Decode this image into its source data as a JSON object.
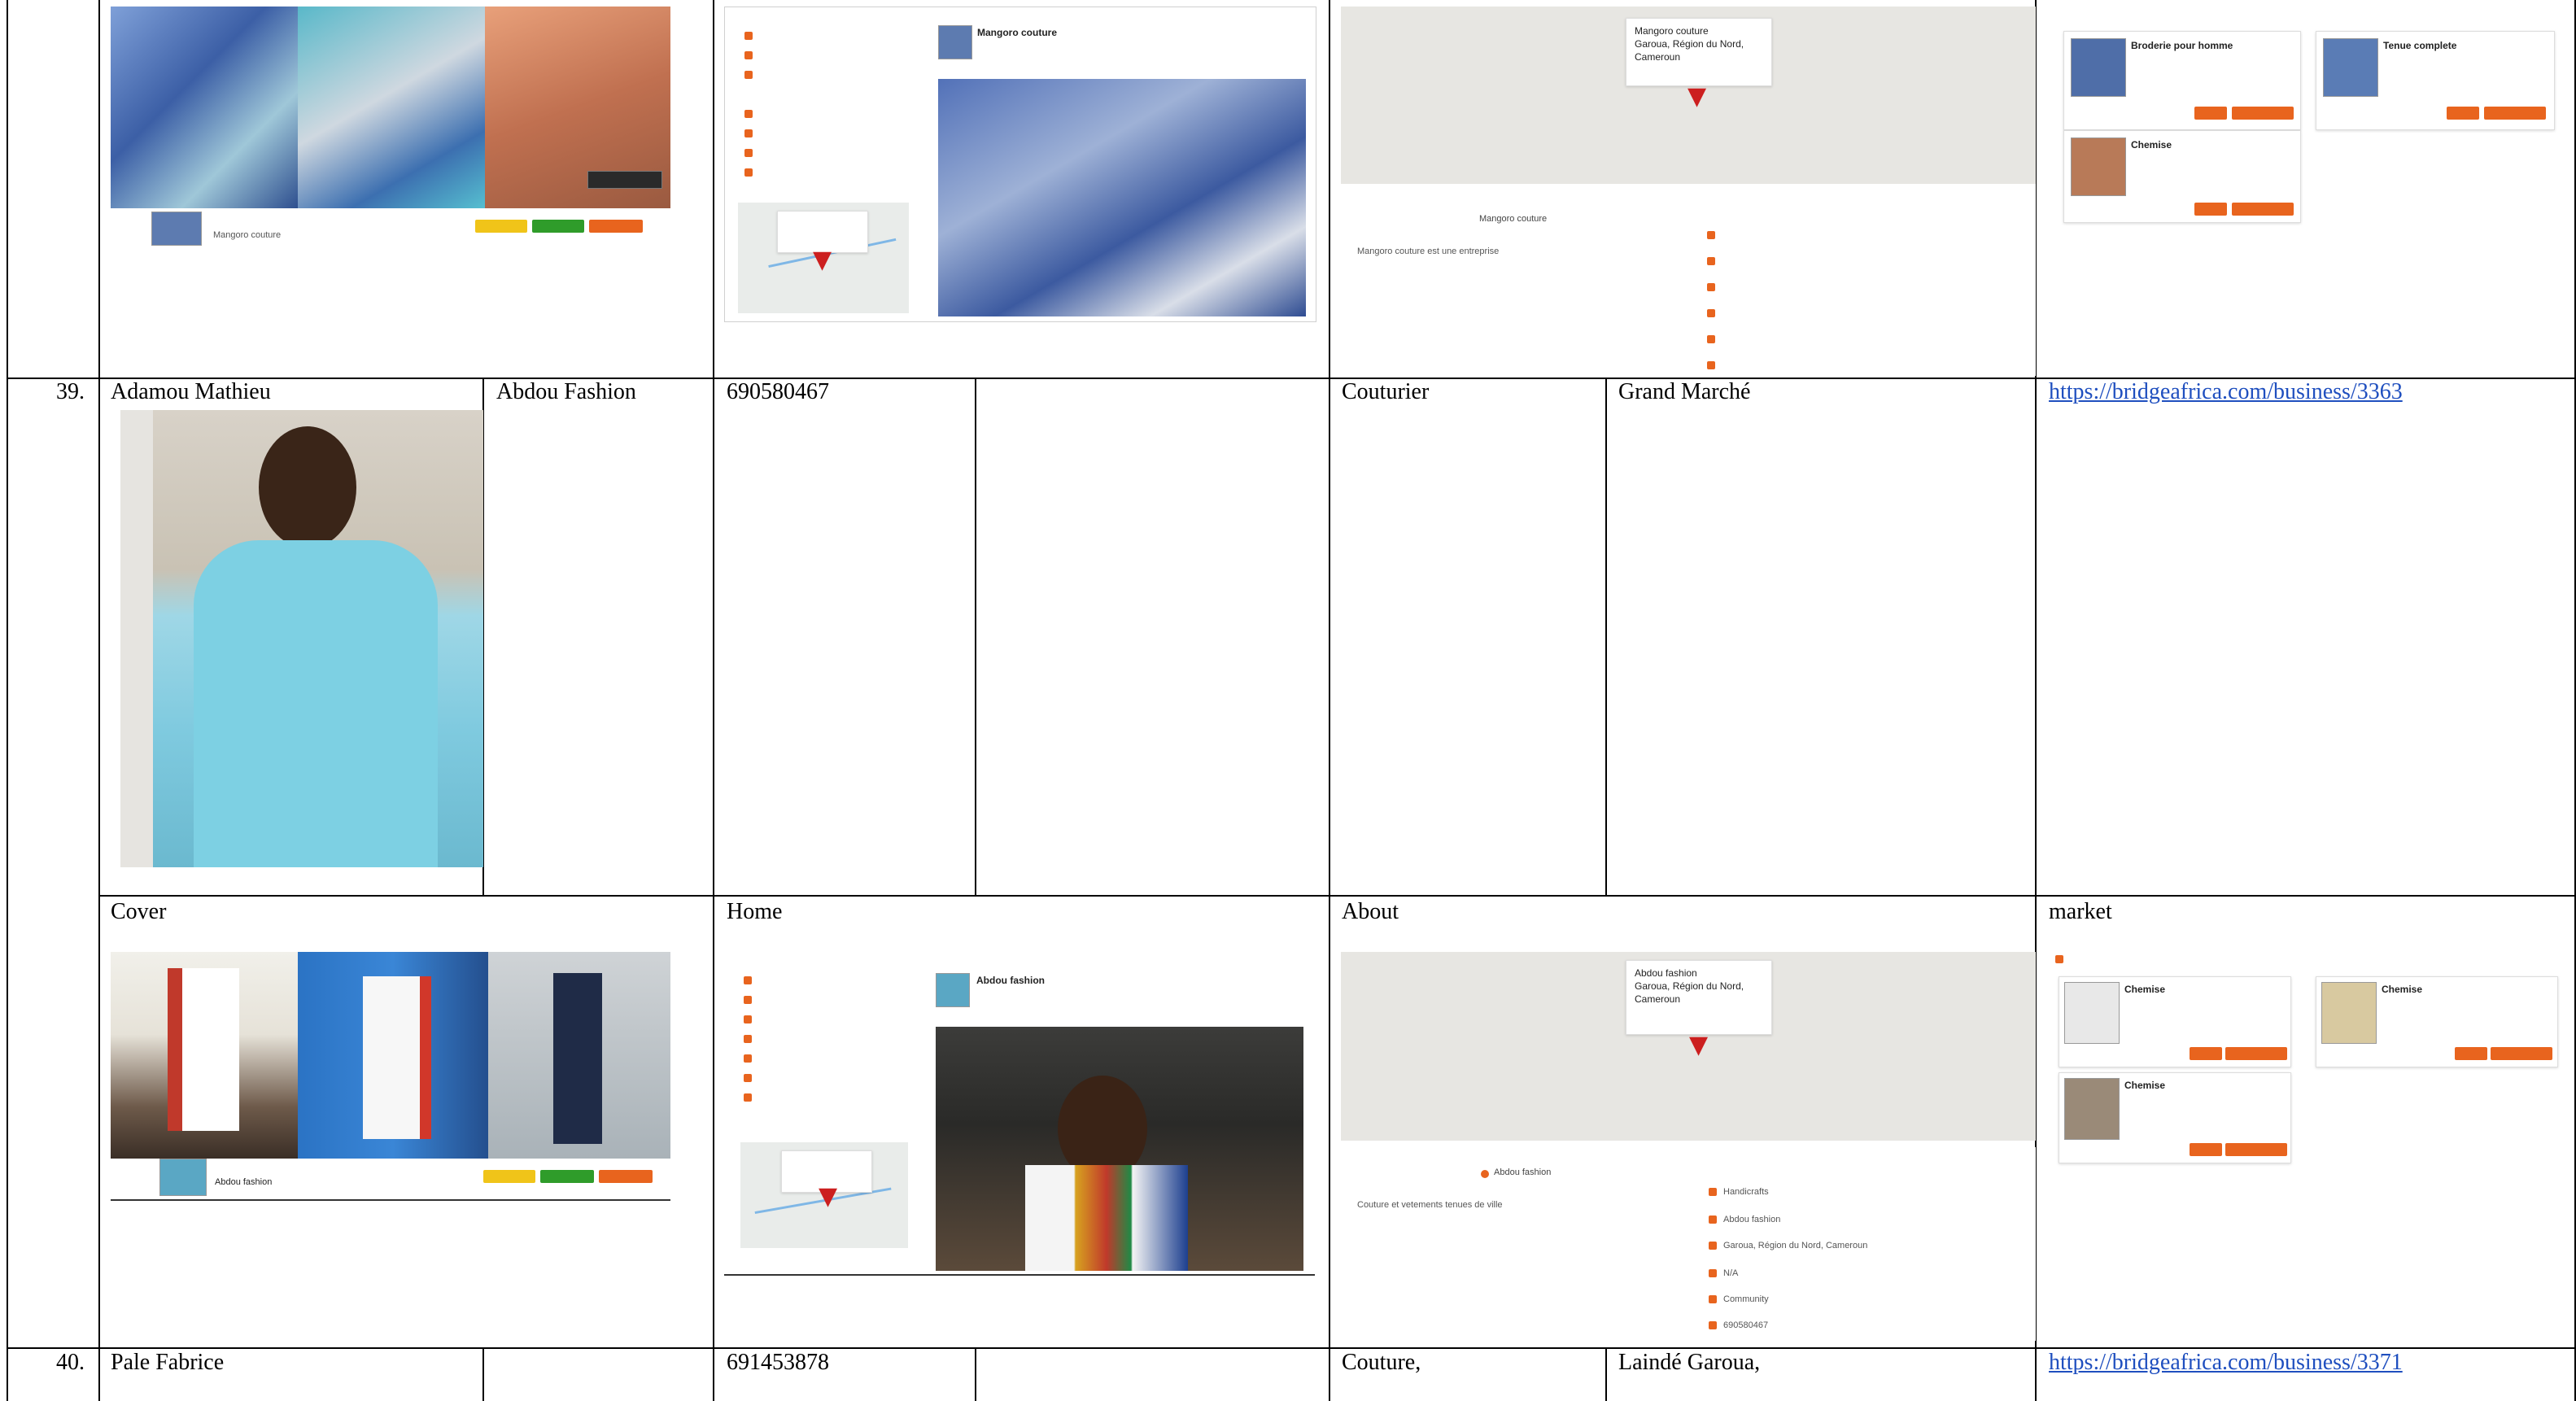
{
  "table": {
    "rows": [
      {
        "number": "39.",
        "name": "Adamou Mathieu",
        "business": "Abdou Fashion",
        "phone": "690580467",
        "category": "Couturier",
        "location": "Grand Marché",
        "url": "https://bridgeafrica.com/business/3363"
      },
      {
        "number": "40.",
        "name": "Pale Fabrice",
        "business": "",
        "phone": "691453878",
        "category": "Couture,",
        "location": "Laindé Garoua,",
        "url": "https://bridgeafrica.com/business/3371"
      }
    ],
    "section_labels": {
      "cover": "Cover",
      "home": "Home",
      "about": "About",
      "market": "market"
    }
  },
  "screens_top": {
    "cover_business": "Mangoro couture",
    "home_business": "Mangoro couture",
    "map_popup": [
      "Mangoro couture",
      "Garoua, Région du Nord,",
      "Cameroun"
    ],
    "about_business": "Mangoro couture",
    "about_desc": "Mangoro couture est une entreprise",
    "market_items": [
      "Broderie pour homme",
      "Tenue complete",
      "Chemise"
    ]
  },
  "screens_bottom": {
    "cover_business": "Abdou fashion",
    "home_business": "Abdou fashion",
    "map_popup": [
      "Abdou fashion",
      "Garoua, Région du Nord,",
      "Cameroun"
    ],
    "about_business": "Abdou fashion",
    "about_desc": "Couture et vetements tenues de ville",
    "about_info": [
      "Handicrafts",
      "Abdou fashion",
      "Garoua, Région du Nord, Cameroun",
      "N/A",
      "Community",
      "690580467"
    ],
    "market_items": [
      "Chemise",
      "Chemise",
      "Chemise"
    ]
  },
  "colors": {
    "link": "#1f4fbf",
    "brand_orange": "#e8641e",
    "brand_green": "#2f9c2a",
    "brand_yellow": "#f0c419"
  }
}
